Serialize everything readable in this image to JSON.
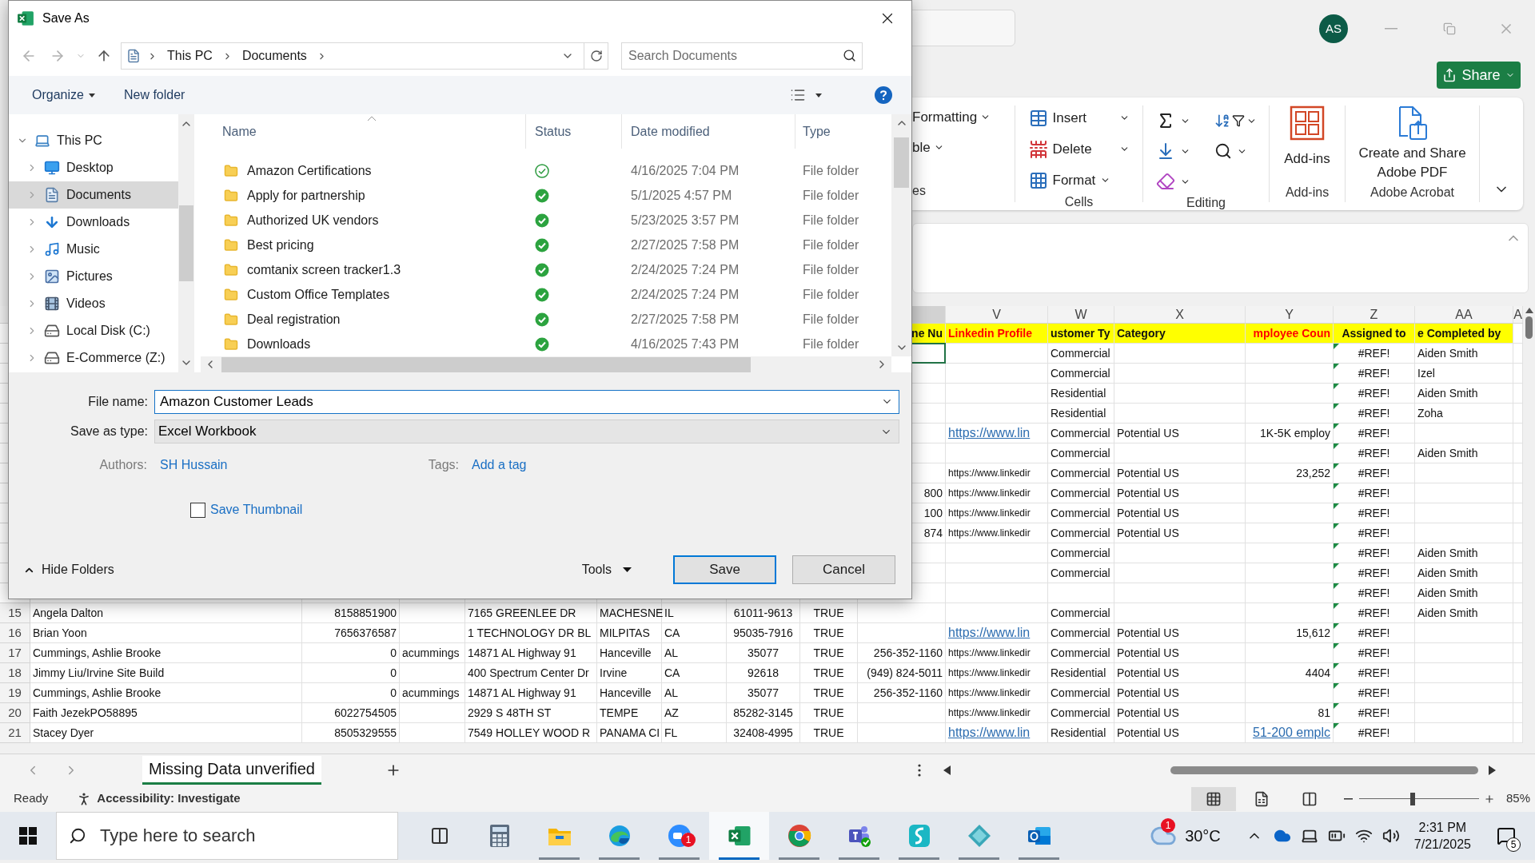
{
  "excel": {
    "avatar": "AS",
    "share": "Share",
    "ribbon": {
      "styles": {
        "items": [
          "Formatting",
          "ble"
        ],
        "label": "es"
      },
      "cells": {
        "items": [
          "Insert",
          "Delete",
          "Format"
        ],
        "label": "Cells"
      },
      "editing": {
        "label": "Editing"
      },
      "addins": {
        "button": "Add-ins",
        "label": "Add-ins"
      },
      "acrobat": {
        "button": "Create and Share Adobe PDF",
        "label": "Adobe Acrobat"
      }
    },
    "sheet": {
      "column_letters": {
        "column_10": "V",
        "column_11": "W",
        "column_12": "X",
        "column_13": "Y",
        "column_14": "Z",
        "column_15": "AA",
        "column_16": "A"
      },
      "rows": [
        {
          "kind": "header",
          "cells": {
            "column_9": {
              "text": "ne Nu",
              "emphasized": false
            },
            "column_10": {
              "text": "Linkedin Profile",
              "emphasized": true
            },
            "column_11": {
              "text": "ustomer Ty",
              "emphasized": false
            },
            "column_12": {
              "text": "Category",
              "emphasized": false
            },
            "column_13": {
              "text": "mployee Coun",
              "emphasized": true
            },
            "column_14": {
              "text": "Assigned to",
              "emphasized": false
            },
            "column_15": {
              "text": "e Completed by",
              "emphasized": false
            }
          }
        },
        {
          "kind": "data",
          "cells": {
            "column_9": {
              "selected": true
            },
            "column_11": "Commercial",
            "column_14": "#REF!",
            "column_15": "Aiden Smith"
          }
        },
        {
          "kind": "data",
          "cells": {
            "column_11": "Commercial",
            "column_14": "#REF!",
            "column_15": "Izel"
          }
        },
        {
          "kind": "data",
          "cells": {
            "column_11": "Residential",
            "column_14": "#REF!",
            "column_15": "Aiden Smith"
          }
        },
        {
          "kind": "data",
          "cells": {
            "column_11": "Residential",
            "column_14": "#REF!",
            "column_15": "Zoha"
          }
        },
        {
          "kind": "data",
          "cells": {
            "column_10": {
              "text": "https://www.lin",
              "link": true
            },
            "column_11": "Commercial",
            "column_12": "Potential US",
            "column_13": "1K-5K employ",
            "column_14": "#REF!"
          }
        },
        {
          "kind": "data",
          "cells": {
            "column_11": "Commercial",
            "column_14": "#REF!",
            "column_15": "Aiden Smith"
          }
        },
        {
          "kind": "data",
          "cells": {
            "column_10": "https://www.linkedir",
            "column_11": "Commercial",
            "column_12": "Potential US",
            "column_13": "23,252",
            "column_14": "#REF!"
          }
        },
        {
          "kind": "data",
          "cells": {
            "column_9": "800",
            "column_10": "https://www.linkedir",
            "column_11": "Commercial",
            "column_12": "Potential US",
            "column_14": "#REF!"
          }
        },
        {
          "kind": "data",
          "cells": {
            "column_9": "100",
            "column_10": "https://www.linkedir",
            "column_11": "Commercial",
            "column_12": "Potential US",
            "column_14": "#REF!"
          }
        },
        {
          "kind": "data",
          "cells": {
            "column_9": "874",
            "column_10": "https://www.linkedir",
            "column_11": "Commercial",
            "column_12": "Potential US",
            "column_14": "#REF!"
          }
        },
        {
          "kind": "data",
          "cells": {
            "column_11": "Commercial",
            "column_14": "#REF!",
            "column_15": "Aiden Smith"
          }
        },
        {
          "kind": "data",
          "cells": {
            "column_11": "Commercial",
            "column_14": "#REF!",
            "column_15": "Aiden Smith"
          }
        },
        {
          "kind": "data",
          "cells": {
            "column_14": "#REF!",
            "column_15": "Aiden Smith"
          }
        },
        {
          "number": "15",
          "kind": "data",
          "cells": {
            "column_1": "Angela Dalton",
            "column_2": "8158851900",
            "column_4": "7165 GREENLEE DR",
            "column_5": "MACHESNE",
            "column_6": "IL",
            "column_7": "61011-9613",
            "column_8": "TRUE",
            "column_11": "Commercial",
            "column_14": "#REF!",
            "column_15": "Aiden Smith"
          }
        },
        {
          "number": "16",
          "kind": "data",
          "cells": {
            "column_1": "Brian Yoon",
            "column_2": "7656376587",
            "column_4": "1 TECHNOLOGY DR BL",
            "column_5": "MILPITAS",
            "column_6": "CA",
            "column_7": "95035-7916",
            "column_8": "TRUE",
            "column_10": {
              "text": "https://www.lin",
              "link": true
            },
            "column_11": "Commercial",
            "column_12": "Potential US",
            "column_13": "15,612",
            "column_14": "#REF!"
          }
        },
        {
          "number": "17",
          "kind": "data",
          "cells": {
            "column_1": "Cummings, Ashlie Brooke",
            "column_2": "0",
            "column_3": "acummings",
            "column_4": "14871 AL Highway 91",
            "column_5": "Hanceville",
            "column_6": "AL",
            "column_7": "35077",
            "column_8": "TRUE",
            "column_9": "256-352-1160",
            "column_10": "https://www.linkedir",
            "column_11": "Commercial",
            "column_12": "Potential US",
            "column_14": "#REF!"
          }
        },
        {
          "number": "18",
          "kind": "data",
          "cells": {
            "column_1": "Jimmy Liu/Irvine Site Build",
            "column_2": "0",
            "column_4": "400 Spectrum Center Dr",
            "column_5": "Irvine",
            "column_6": "CA",
            "column_7": "92618",
            "column_8": "TRUE",
            "column_9": "(949) 824-5011",
            "column_10": "https://www.linkedir",
            "column_11": "Residential",
            "column_12": "Potential US",
            "column_13": "4404",
            "column_14": "#REF!"
          }
        },
        {
          "number": "19",
          "kind": "data",
          "cells": {
            "column_1": "Cummings, Ashlie Brooke",
            "column_2": "0",
            "column_3": "acummings",
            "column_4": "14871 AL Highway 91",
            "column_5": "Hanceville",
            "column_6": "AL",
            "column_7": "35077",
            "column_8": "TRUE",
            "column_9": "256-352-1160",
            "column_10": "https://www.linkedir",
            "column_11": "Commercial",
            "column_12": "Potential US",
            "column_14": "#REF!"
          }
        },
        {
          "number": "20",
          "kind": "data",
          "cells": {
            "column_1": "Faith JezekPO58895",
            "column_2": "6022754505",
            "column_4": "2929 S 48TH ST",
            "column_5": "TEMPE",
            "column_6": "AZ",
            "column_7": "85282-3145",
            "column_8": "TRUE",
            "column_10": "https://www.linkedir",
            "column_11": "Commercial",
            "column_12": "Potential US",
            "column_13": "81",
            "column_14": "#REF!"
          }
        },
        {
          "number": "21",
          "kind": "data",
          "cells": {
            "column_1": "Stacey Dyer",
            "column_2": "8505329555",
            "column_4": "7549 HOLLEY WOOD R",
            "column_5": "PANAMA CI",
            "column_6": "FL",
            "column_7": "32408-4995",
            "column_8": "TRUE",
            "column_10": {
              "text": "https://www.lin",
              "link": true
            },
            "column_11": "Residential",
            "column_12": "Potential US",
            "column_13": {
              "text": "51-200 emplc",
              "link": true
            },
            "column_14": "#REF!"
          }
        }
      ],
      "tab": "Missing Data unverified"
    },
    "status_bar": {
      "ready": "Ready",
      "accessibility": "Accessibility: Investigate",
      "zoom": {
        "label": "85%",
        "level": 0.45
      }
    }
  },
  "dialog": {
    "title": "Save As",
    "breadcrumb": [
      "This PC",
      "Documents"
    ],
    "search": {
      "placeholder": "Search Documents"
    },
    "organize": "Organize",
    "new_folder": "New folder",
    "nav_tree": [
      {
        "label": "This PC",
        "kind": "computer",
        "expanded": true,
        "selected": false,
        "children": [
          {
            "label": "Desktop",
            "kind": "desktop",
            "expanded": false,
            "selected": false
          },
          {
            "label": "Documents",
            "kind": "documents",
            "expanded": false,
            "selected": true
          },
          {
            "label": "Downloads",
            "kind": "downloads",
            "expanded": false,
            "selected": false
          },
          {
            "label": "Music",
            "kind": "music",
            "expanded": false,
            "selected": false
          },
          {
            "label": "Pictures",
            "kind": "pictures",
            "expanded": false,
            "selected": false
          },
          {
            "label": "Videos",
            "kind": "videos",
            "expanded": false,
            "selected": false
          },
          {
            "label": "Local Disk (C:)",
            "kind": "drive",
            "expanded": false,
            "selected": false
          },
          {
            "label": "E-Commerce (Z:)",
            "kind": "network_drive",
            "expanded": false,
            "selected": false
          }
        ]
      }
    ],
    "columns": [
      "Name",
      "Status",
      "Date modified",
      "Type"
    ],
    "files": [
      {
        "name": "Amazon Certifications",
        "always_available": false,
        "date": "4/16/2025 7:04 PM",
        "type": "File folder"
      },
      {
        "name": "Apply for partnership",
        "always_available": true,
        "date": "5/1/2025 4:57 PM",
        "type": "File folder"
      },
      {
        "name": "Authorized UK vendors",
        "always_available": true,
        "date": "5/23/2025 3:57 PM",
        "type": "File folder"
      },
      {
        "name": "Best pricing",
        "always_available": true,
        "date": "2/27/2025 7:58 PM",
        "type": "File folder"
      },
      {
        "name": "comtanix screen tracker1.3",
        "always_available": true,
        "date": "2/24/2025 7:24 PM",
        "type": "File folder"
      },
      {
        "name": "Custom Office Templates",
        "always_available": true,
        "date": "2/24/2025 7:24 PM",
        "type": "File folder"
      },
      {
        "name": "Deal registration",
        "always_available": true,
        "date": "2/27/2025 7:58 PM",
        "type": "File folder"
      },
      {
        "name": "Downloads",
        "always_available": true,
        "date": "4/16/2025 7:43 PM",
        "type": "File folder"
      }
    ],
    "file_name": {
      "label": "File name:",
      "value": "Amazon Customer Leads"
    },
    "save_as_type": {
      "label": "Save as type:",
      "value": "Excel Workbook"
    },
    "authors": {
      "label": "Authors:",
      "value": "SH Hussain"
    },
    "tags": {
      "label": "Tags:",
      "value": "Add a tag"
    },
    "save_thumbnail": {
      "label": "Save Thumbnail",
      "checked": false
    },
    "hide_folders": "Hide Folders",
    "tools": "Tools",
    "buttons": [
      {
        "label": "Save",
        "default": true
      },
      {
        "label": "Cancel",
        "default": false
      }
    ]
  },
  "taskbar": {
    "search": {
      "placeholder": "Type here to search"
    },
    "apps": [
      {
        "kind": "task_view",
        "running": false,
        "active": false
      },
      {
        "kind": "calculator",
        "running": false,
        "active": false
      },
      {
        "kind": "file_explorer",
        "running": true,
        "active": false
      },
      {
        "kind": "edge",
        "running": true,
        "active": false
      },
      {
        "kind": "zoom",
        "running": true,
        "active": false,
        "badge": "1"
      },
      {
        "kind": "excel",
        "running": true,
        "active": true
      },
      {
        "kind": "chrome",
        "running": true,
        "active": false
      },
      {
        "kind": "teams",
        "running": true,
        "active": false
      },
      {
        "kind": "surfshark",
        "running": true,
        "active": false
      },
      {
        "kind": "diamond",
        "running": true,
        "active": false
      },
      {
        "kind": "outlook",
        "running": true,
        "active": false
      }
    ],
    "weather": {
      "temperature": "30°C",
      "badge": "1"
    },
    "time": "2:31 PM",
    "date": "7/21/2025",
    "notifications": "5"
  }
}
